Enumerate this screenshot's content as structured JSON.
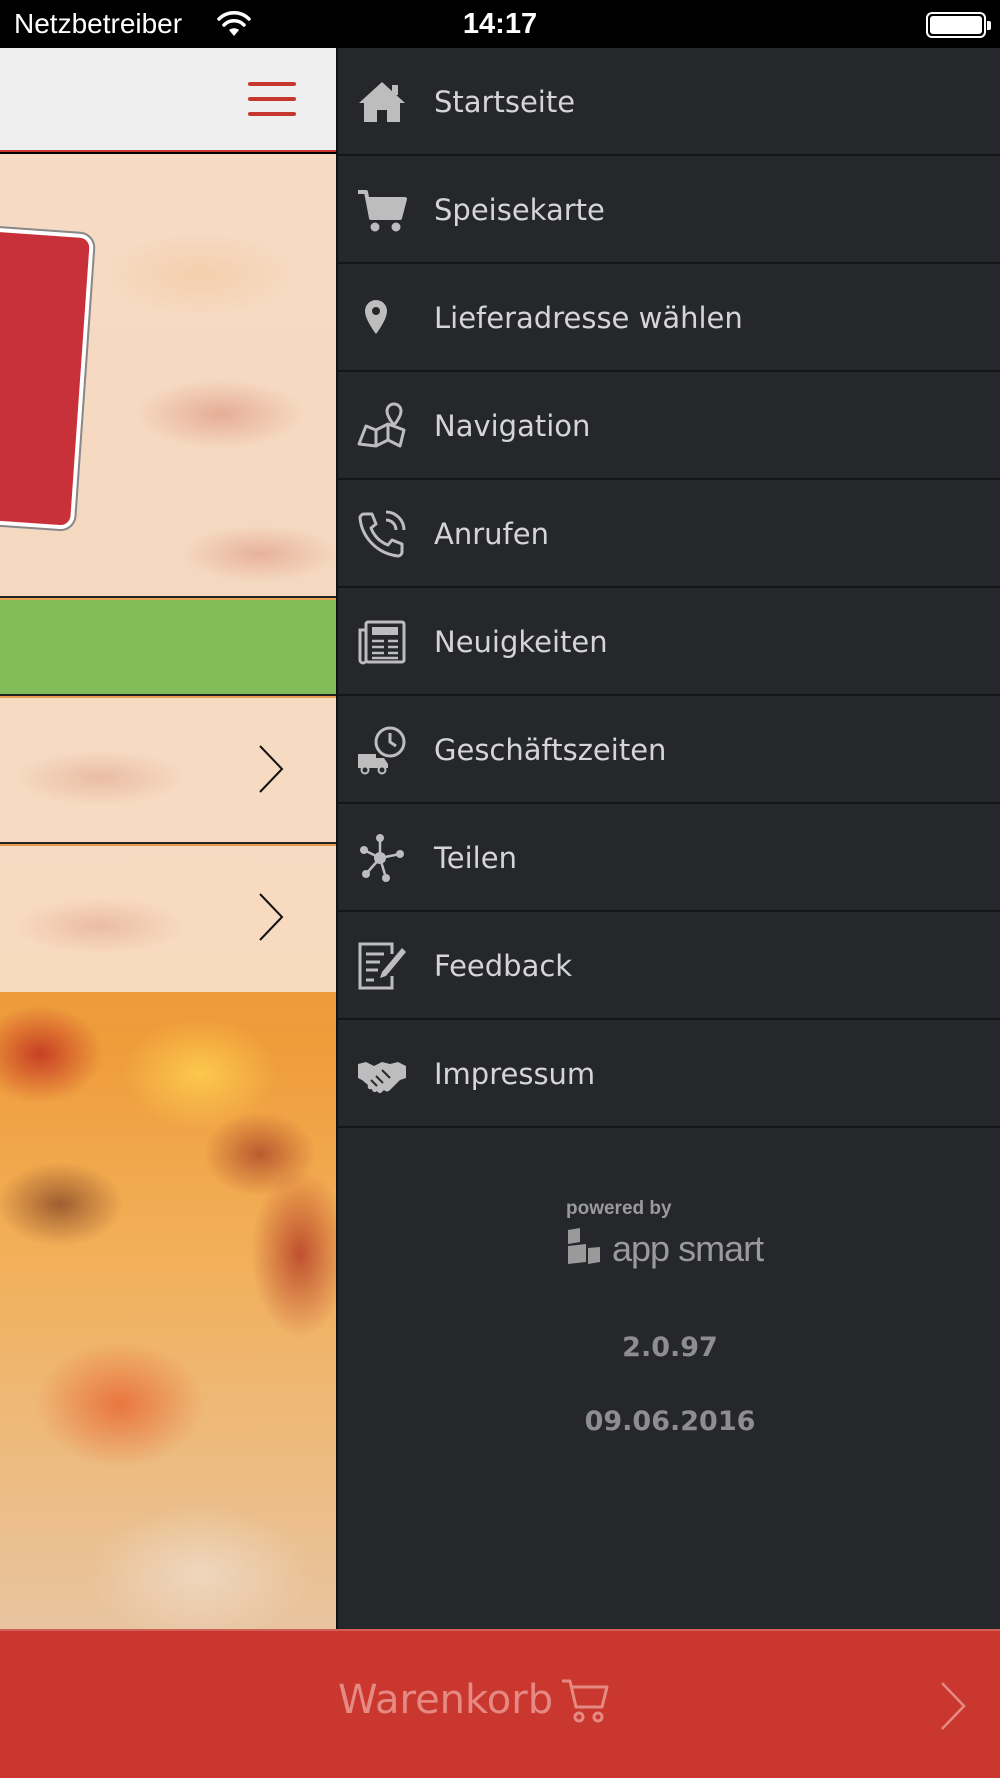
{
  "status_bar": {
    "carrier": "Netzbetreiber",
    "time": "14:17"
  },
  "drawer": {
    "items": [
      {
        "label": "Startseite",
        "icon": "home-icon"
      },
      {
        "label": "Speisekarte",
        "icon": "cart-icon"
      },
      {
        "label": "Lieferadresse wählen",
        "icon": "map-pin-icon"
      },
      {
        "label": "Navigation",
        "icon": "map-icon"
      },
      {
        "label": "Anrufen",
        "icon": "phone-icon"
      },
      {
        "label": "Neuigkeiten",
        "icon": "news-icon"
      },
      {
        "label": "Geschäftszeiten",
        "icon": "delivery-clock-icon"
      },
      {
        "label": "Teilen",
        "icon": "share-icon"
      },
      {
        "label": "Feedback",
        "icon": "feedback-icon"
      },
      {
        "label": "Impressum",
        "icon": "handshake-icon"
      }
    ],
    "powered_by": "powered by",
    "brand": "app smart",
    "version": "2.0.97",
    "date": "09.06.2016"
  },
  "cart": {
    "label": "Warenkorb"
  },
  "colors": {
    "drawer_bg": "#25272a",
    "accent_red": "#c9372f",
    "green_bar": "#82bd5a",
    "menu_text": "#d5d5d5"
  }
}
